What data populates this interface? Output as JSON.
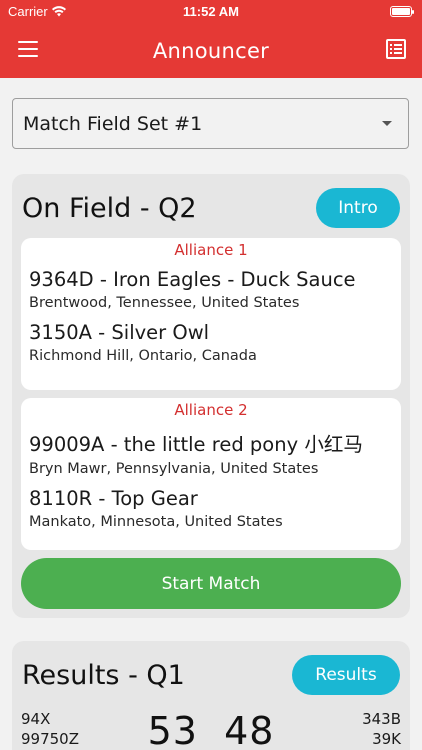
{
  "status_bar": {
    "carrier": "Carrier",
    "time": "11:52 AM"
  },
  "app_bar": {
    "title": "Announcer"
  },
  "match_field_select": {
    "value": "Match Field Set #1"
  },
  "on_field": {
    "title": "On Field - Q2",
    "intro_label": "Intro",
    "alliances": [
      {
        "label": "Alliance 1",
        "teams": [
          {
            "name": "9364D - Iron Eagles - Duck Sauce",
            "location": "Brentwood, Tennessee, United States"
          },
          {
            "name": "3150A - Silver Owl",
            "location": "Richmond Hill, Ontario, Canada"
          }
        ]
      },
      {
        "label": "Alliance 2",
        "teams": [
          {
            "name": "99009A - the little red pony 小红马",
            "location": "Bryn Mawr, Pennsylvania, United States"
          },
          {
            "name": "8110R - Top Gear",
            "location": "Mankato, Minnesota, United States"
          }
        ]
      }
    ],
    "start_label": "Start Match"
  },
  "results": {
    "title": "Results - Q1",
    "results_label": "Results",
    "left_teams": [
      "94X",
      "99750Z"
    ],
    "right_teams": [
      "343B",
      "39K"
    ],
    "score": "53  48"
  },
  "colors": {
    "app_bar": "#e53935",
    "pill": "#1ab7d3",
    "start": "#4caf50",
    "alliance_label": "#d32f2f"
  }
}
